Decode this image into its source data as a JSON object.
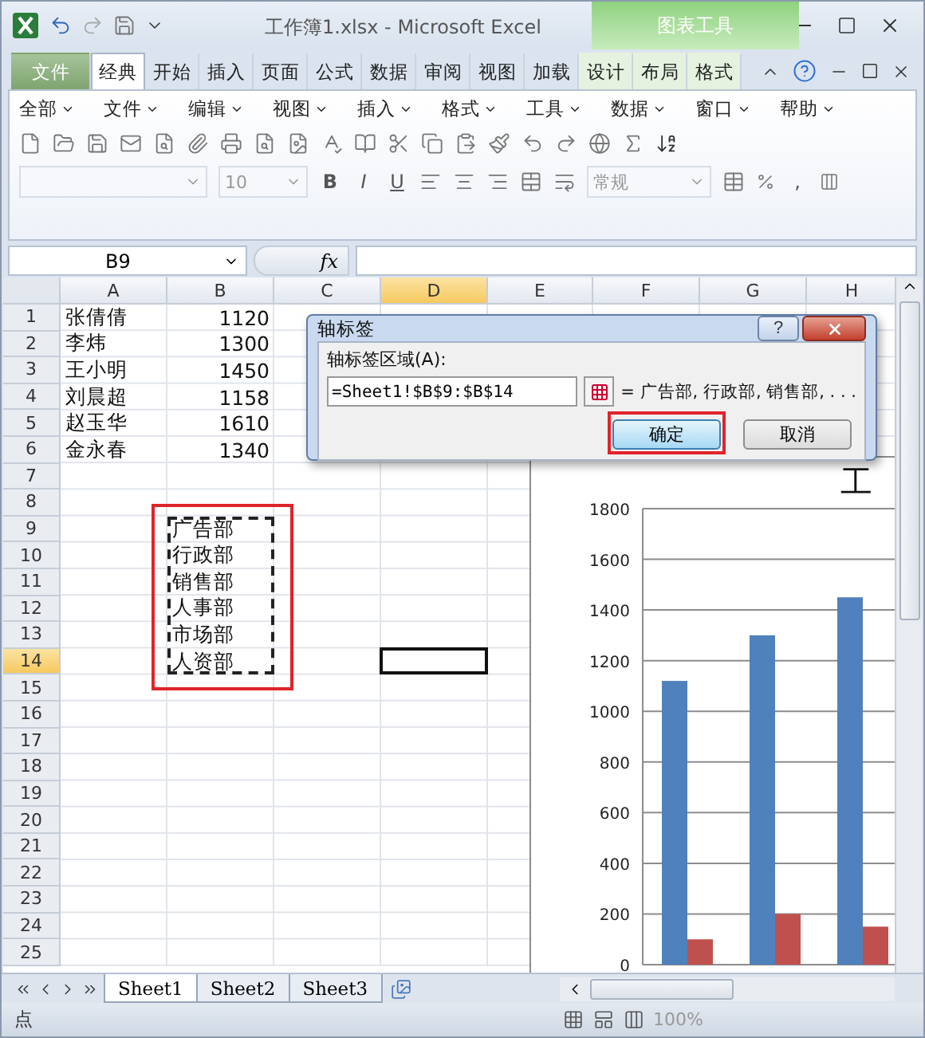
{
  "window": {
    "title": "工作簿1.xlsx  -  Microsoft Excel",
    "context_group": "图表工具"
  },
  "ribbon_tabs": [
    {
      "label": "文件",
      "kind": "file",
      "selected": false
    },
    {
      "label": "经典",
      "kind": "normal",
      "selected": true
    },
    {
      "label": "开始",
      "kind": "normal",
      "selected": false
    },
    {
      "label": "插入",
      "kind": "normal",
      "selected": false
    },
    {
      "label": "页面",
      "kind": "normal",
      "selected": false
    },
    {
      "label": "公式",
      "kind": "normal",
      "selected": false
    },
    {
      "label": "数据",
      "kind": "normal",
      "selected": false
    },
    {
      "label": "审阅",
      "kind": "normal",
      "selected": false
    },
    {
      "label": "视图",
      "kind": "normal",
      "selected": false
    },
    {
      "label": "加载",
      "kind": "normal",
      "selected": false
    },
    {
      "label": "设计",
      "kind": "context",
      "selected": false
    },
    {
      "label": "布局",
      "kind": "context",
      "selected": false
    },
    {
      "label": "格式",
      "kind": "context",
      "selected": false
    }
  ],
  "menu": [
    "全部",
    "文件",
    "编辑",
    "视图",
    "插入",
    "格式",
    "工具",
    "数据",
    "窗口",
    "帮助"
  ],
  "toolbar": {
    "font_size": "10",
    "number_format": "常规",
    "style_buttons": [
      "B",
      "I",
      "U"
    ],
    "comma": ","
  },
  "formula_bar": {
    "name_box": "B9",
    "function_label": "fx"
  },
  "sheet": {
    "columns": [
      {
        "label": "A",
        "selected": false
      },
      {
        "label": "B",
        "selected": false
      },
      {
        "label": "C",
        "selected": false
      },
      {
        "label": "D",
        "selected": true
      },
      {
        "label": "E",
        "selected": false
      },
      {
        "label": "F",
        "selected": false
      },
      {
        "label": "G",
        "selected": false
      },
      {
        "label": "H",
        "selected": false
      }
    ],
    "rows": [
      {
        "header": "1",
        "selected": false,
        "marquee": false,
        "a": "张倩倩",
        "b": "1120"
      },
      {
        "header": "2",
        "selected": false,
        "marquee": false,
        "a": "李炜",
        "b": "1300"
      },
      {
        "header": "3",
        "selected": false,
        "marquee": false,
        "a": "王小明",
        "b": "1450"
      },
      {
        "header": "4",
        "selected": false,
        "marquee": false,
        "a": "刘晨超",
        "b": "1158"
      },
      {
        "header": "5",
        "selected": false,
        "marquee": false,
        "a": "赵玉华",
        "b": "1610"
      },
      {
        "header": "6",
        "selected": false,
        "marquee": false,
        "a": "金永春",
        "b": "1340"
      },
      {
        "header": "7",
        "selected": false,
        "marquee": false
      },
      {
        "header": "8",
        "selected": false,
        "marquee": false
      },
      {
        "header": "9",
        "selected": false,
        "marquee": true,
        "b": "广告部"
      },
      {
        "header": "10",
        "selected": false,
        "marquee": true,
        "b": "行政部"
      },
      {
        "header": "11",
        "selected": false,
        "marquee": true,
        "b": "销售部"
      },
      {
        "header": "12",
        "selected": false,
        "marquee": true,
        "b": "人事部"
      },
      {
        "header": "13",
        "selected": false,
        "marquee": true,
        "b": "市场部"
      },
      {
        "header": "14",
        "selected": true,
        "marquee": true,
        "b": "人资部"
      },
      {
        "header": "15",
        "selected": false,
        "marquee": false
      },
      {
        "header": "16",
        "selected": false,
        "marquee": false
      },
      {
        "header": "17",
        "selected": false,
        "marquee": false
      },
      {
        "header": "18",
        "selected": false,
        "marquee": false
      },
      {
        "header": "19",
        "selected": false,
        "marquee": false
      },
      {
        "header": "20",
        "selected": false,
        "marquee": false
      },
      {
        "header": "21",
        "selected": false,
        "marquee": false
      },
      {
        "header": "22",
        "selected": false,
        "marquee": false
      },
      {
        "header": "23",
        "selected": false,
        "marquee": false
      },
      {
        "header": "24",
        "selected": false,
        "marquee": false
      },
      {
        "header": "25",
        "selected": false,
        "marquee": false
      }
    ]
  },
  "chart": {
    "title": "工",
    "chart_data": {
      "type": "bar",
      "grid": true,
      "ylim": [
        0,
        1800
      ],
      "yticks": [
        0,
        200,
        400,
        600,
        800,
        1000,
        1200,
        1400,
        1600,
        1800
      ],
      "series": [
        {
          "color": "#4f81bd",
          "values": [
            1120,
            1300,
            1450
          ]
        },
        {
          "color": "#c0504d",
          "values": [
            100,
            200,
            150
          ]
        }
      ]
    }
  },
  "dialog": {
    "title": "轴标签",
    "help": "?",
    "field_label": "轴标签区域(A):",
    "value": "=Sheet1!$B$9:$B$14",
    "preview": "= 广告部, 行政部, 销售部, . . .",
    "buttons": [
      {
        "label": "确定",
        "highlighted": true
      },
      {
        "label": "取消",
        "highlighted": false
      }
    ]
  },
  "sheet_tabs": [
    {
      "label": "Sheet1",
      "selected": true
    },
    {
      "label": "Sheet2",
      "selected": false
    },
    {
      "label": "Sheet3",
      "selected": false
    }
  ],
  "status_bar": {
    "mode": "点",
    "zoom": "100%"
  }
}
